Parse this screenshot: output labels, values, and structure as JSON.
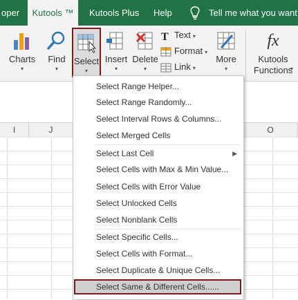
{
  "tabs": [
    {
      "label": "oper",
      "active": false
    },
    {
      "label": "Kutools ™",
      "active": true
    },
    {
      "label": "Kutools Plus",
      "active": false
    },
    {
      "label": "Help",
      "active": false
    },
    {
      "label": "Tell me what you want to",
      "active": false
    }
  ],
  "ribbon": {
    "charts": "Charts",
    "find": "Find",
    "select": "Select",
    "insert": "Insert",
    "delete": "Delete",
    "text": "Text",
    "format": "Format",
    "link": "Link",
    "more": "More",
    "kutools_functions_1": "Kutools",
    "kutools_functions_2": "Functions",
    "fx": "fx",
    "caret": "▾"
  },
  "columns": [
    "I",
    "J",
    "O"
  ],
  "menu": {
    "items": [
      "Select Range Helper...",
      "Select Range Randomly...",
      "Select Interval Rows & Columns...",
      "Select Merged Cells",
      "Select Last Cell",
      "Select Cells with Max & Min Value...",
      "Select Cells with Error Value",
      "Select Unlocked Cells",
      "Select Nonblank Cells",
      "Select Specific Cells...",
      "Select Cells with Format...",
      "Select Duplicate & Unique Cells...",
      "Select Same & Different Cells......"
    ],
    "submenu_arrow": "▶"
  },
  "colors": {
    "accent": "#217346",
    "highlight_border": "#7a1a1a"
  }
}
